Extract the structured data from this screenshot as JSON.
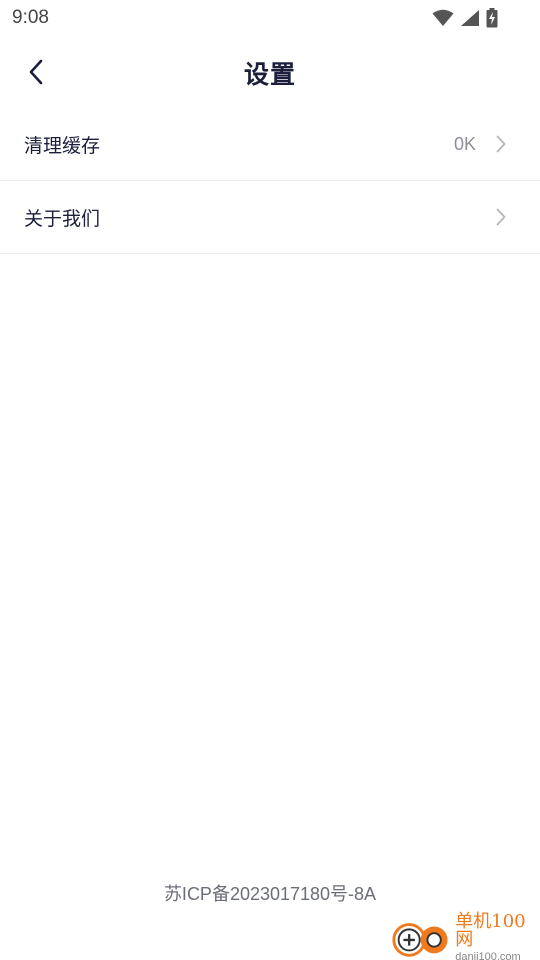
{
  "status_bar": {
    "time": "9:08",
    "icons": [
      "wifi-icon",
      "signal-icon",
      "battery-charging-icon"
    ]
  },
  "header": {
    "back_icon": "chevron-left-icon",
    "title": "设置"
  },
  "settings": {
    "items": [
      {
        "label": "清理缓存",
        "value": "0K",
        "chevron": "chevron-right-icon"
      },
      {
        "label": "关于我们",
        "value": "",
        "chevron": "chevron-right-icon"
      }
    ]
  },
  "footer": {
    "icp": "苏ICP备2023017180号-8A"
  },
  "watermark": {
    "brand": "单机100网",
    "url": "danji100.com"
  },
  "colors": {
    "title": "#1b1f3b",
    "text": "#1b1f3b",
    "muted": "#8c8f9a",
    "divider": "#ececec",
    "brand_orange": "#f07a1c"
  }
}
